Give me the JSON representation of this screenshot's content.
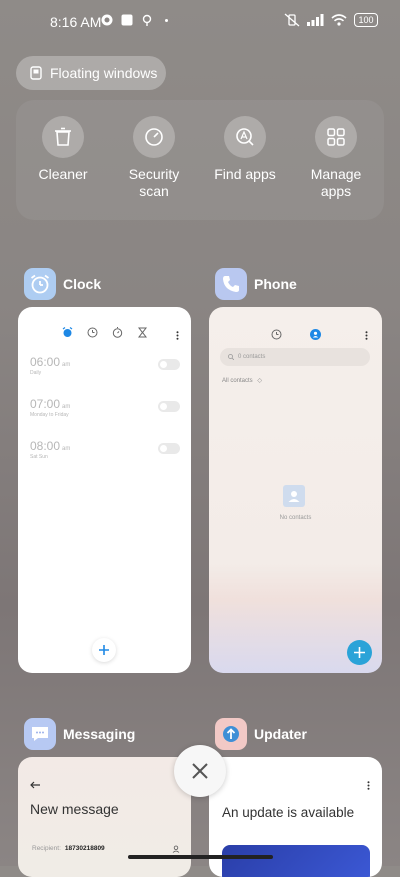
{
  "status_bar": {
    "time": "8:16 AM",
    "battery": "100"
  },
  "floating_windows": {
    "label": "Floating windows"
  },
  "quick_actions": [
    {
      "icon": "trash-icon",
      "label_lines": [
        "Cleaner"
      ]
    },
    {
      "icon": "gauge-icon",
      "label_lines": [
        "Security",
        "scan"
      ]
    },
    {
      "icon": "app-search-icon",
      "label_lines": [
        "Find apps"
      ]
    },
    {
      "icon": "grid-icon",
      "label_lines": [
        "Manage",
        "apps"
      ]
    }
  ],
  "recent_apps": {
    "clock": {
      "name": "Clock",
      "alarms": [
        {
          "time": "06:00",
          "ampm": "am",
          "repeat": "Daily"
        },
        {
          "time": "07:00",
          "ampm": "am",
          "repeat": "Monday to Friday"
        },
        {
          "time": "08:00",
          "ampm": "am",
          "repeat": "Sat Sun"
        }
      ]
    },
    "phone": {
      "name": "Phone",
      "search_placeholder": "0 contacts",
      "filter_label": "All contacts",
      "empty_text": "No contacts"
    },
    "messaging": {
      "name": "Messaging",
      "title": "New message",
      "recipient_label": "Recipient:",
      "recipient_value": "18730218809"
    },
    "updater": {
      "name": "Updater",
      "title": "An update is available"
    }
  },
  "colors": {
    "accent_blue": "#1e88e5",
    "phone_fab": "#2aa3d8"
  }
}
